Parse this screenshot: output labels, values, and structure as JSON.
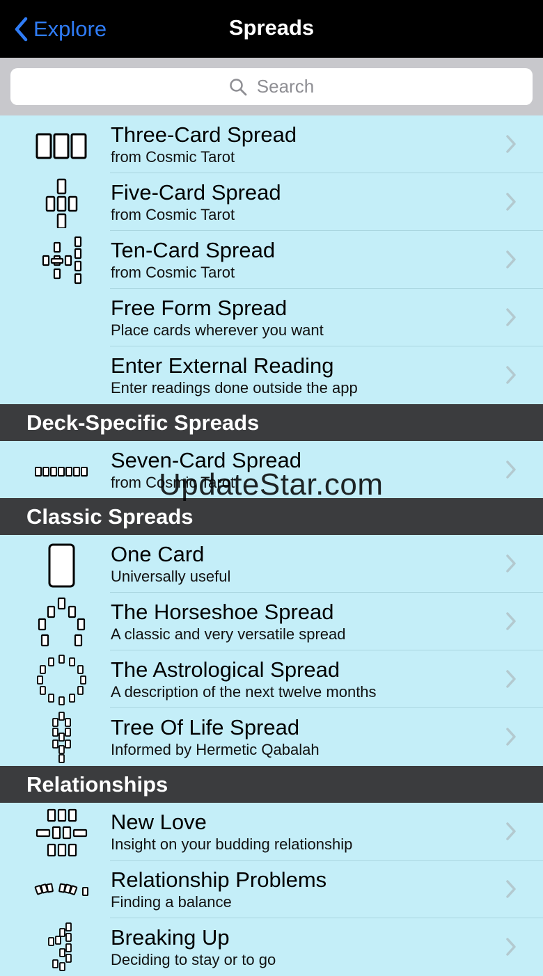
{
  "navbar": {
    "back_label": "Explore",
    "title": "Spreads"
  },
  "search": {
    "placeholder": "Search"
  },
  "rows": [
    {
      "title": "Three-Card Spread",
      "subtitle": "from Cosmic Tarot",
      "icon": "three-card-layout-icon"
    },
    {
      "title": "Five-Card Spread",
      "subtitle": "from Cosmic Tarot",
      "icon": "five-card-cross-icon"
    },
    {
      "title": "Ten-Card Spread",
      "subtitle": "from Cosmic Tarot",
      "icon": "celtic-cross-icon"
    },
    {
      "title": "Free Form Spread",
      "subtitle": "Place cards wherever you want",
      "icon": ""
    },
    {
      "title": "Enter External Reading",
      "subtitle": "Enter readings done outside the app",
      "icon": ""
    },
    {
      "title": "Seven-Card Spread",
      "subtitle": "from Cosmic Tarot",
      "icon": "seven-card-row-icon"
    },
    {
      "title": "One Card",
      "subtitle": "Universally useful",
      "icon": "single-card-icon"
    },
    {
      "title": "The Horseshoe Spread",
      "subtitle": "A classic and very versatile spread",
      "icon": "horseshoe-layout-icon"
    },
    {
      "title": "The Astrological Spread",
      "subtitle": "A description of the next twelve months",
      "icon": "astrological-circle-icon"
    },
    {
      "title": "Tree Of Life Spread",
      "subtitle": "Informed by Hermetic Qabalah",
      "icon": "tree-of-life-icon"
    },
    {
      "title": "New Love",
      "subtitle": "Insight on your budding relationship",
      "icon": "new-love-layout-icon"
    },
    {
      "title": "Relationship Problems",
      "subtitle": "Finding a balance",
      "icon": "relationship-problems-icon"
    },
    {
      "title": "Breaking Up",
      "subtitle": "Deciding to stay or to go",
      "icon": "breaking-up-layout-icon"
    }
  ],
  "sections": {
    "deck_specific": "Deck-Specific Spreads",
    "classic": "Classic Spreads",
    "relationships": "Relationships"
  },
  "watermark": "UpdateStar.com",
  "colors": {
    "accent": "#2f7cf6",
    "row_bg": "#c4eef8",
    "section_bg": "#3b3c3e"
  }
}
